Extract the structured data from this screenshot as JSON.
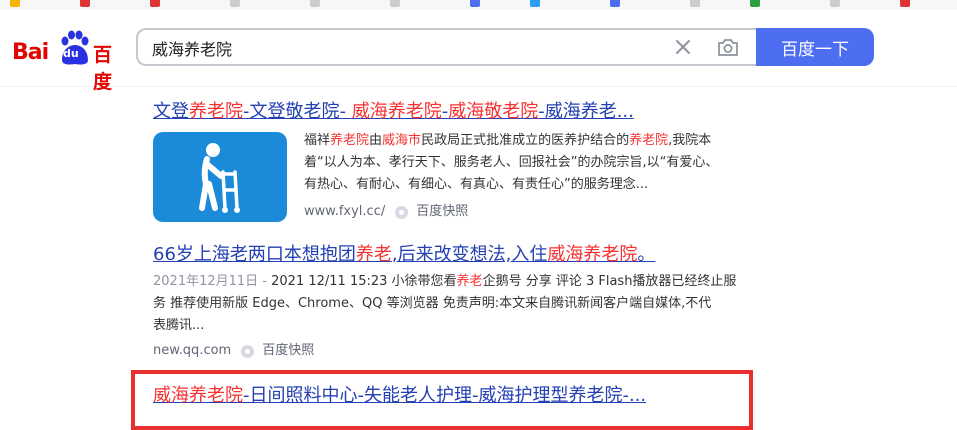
{
  "colors": {
    "accent": "#4e6ef2",
    "link": "#2440b3",
    "highlight": "#f73131",
    "annotation_box": "#e8302f"
  },
  "search": {
    "query": "威海养老院",
    "button_label": "百度一下"
  },
  "logo": {
    "text_latin": "Bai",
    "text_du": "du",
    "text_cn": "百度"
  },
  "results": [
    {
      "title_parts": [
        "文登",
        "养老院",
        "-文登敬老院- ",
        "威海养老院",
        "-",
        "威海敬老院",
        "-威海养老..."
      ],
      "abstract_lines": [
        [
          "福祥",
          "养老院",
          "由",
          "威海市",
          "民政局正式批准成立的医养护结合的",
          "养老院",
          ",我院本"
        ],
        [
          "着“以人为本、孝行天下、服务老人、回报社会”的办院宗旨,以“有爱心、"
        ],
        [
          "有热心、有耐心、有细心、有真心、有责任心”的服务理念..."
        ]
      ],
      "source": "www.fxyl.cc/",
      "snapshot": "百度快照",
      "thumb_icon": "elderly-walker-icon"
    },
    {
      "title_parts": [
        "66岁上海老两口本想抱团",
        "养老",
        ",后来改变想法,入住",
        "威海养老院",
        "。"
      ],
      "date": "2021年12月11日 - ",
      "abstract_lines": [
        [
          "2021 12/11 15:23 小徐带您看",
          "养老",
          "企鹅号 分享 评论 3 Flash播放器已经终止服"
        ],
        [
          "务 推荐使用新版 Edge、Chrome、QQ 等浏览器 免责声明:本文来自腾讯新闻客户端自媒体,不代"
        ],
        [
          "表腾讯..."
        ]
      ],
      "source": "new.qq.com",
      "snapshot": "百度快照"
    },
    {
      "title_parts": [
        "威海养老院",
        "-日间照料中心-失能老人护理-威海护理型养老院-..."
      ]
    }
  ]
}
